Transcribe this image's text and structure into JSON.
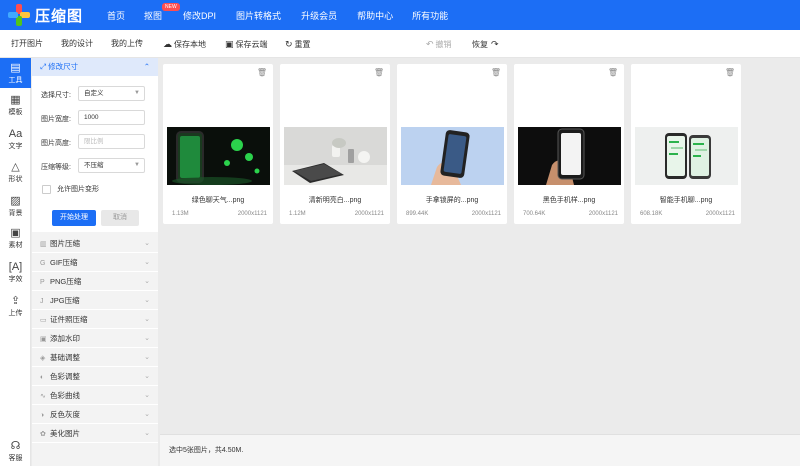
{
  "brand": {
    "name": "压缩图",
    "colors": {
      "primary": "#1c6ef5",
      "logo": [
        "#ff4d4f",
        "#ffc53d",
        "#52c41a",
        "#40a9ff"
      ]
    }
  },
  "nav": {
    "items": [
      {
        "label": "首页"
      },
      {
        "label": "抠图",
        "badge": "NEW"
      },
      {
        "label": "修改DPI"
      },
      {
        "label": "图片转格式"
      },
      {
        "label": "升级会员"
      },
      {
        "label": "帮助中心"
      },
      {
        "label": "所有功能"
      }
    ]
  },
  "toolbar": {
    "open_image": "打开图片",
    "my_designs": "我的设计",
    "my_uploads": "我的上传",
    "save_local": "保存本地",
    "save_cloud": "保存云端",
    "reset": "重置",
    "undo": "撤销",
    "redo": "恢复"
  },
  "rail": {
    "items": [
      {
        "label": "工具",
        "icon": "toolbox-icon",
        "active": true
      },
      {
        "label": "模板",
        "icon": "template-icon"
      },
      {
        "label": "文字",
        "icon": "text-icon"
      },
      {
        "label": "形状",
        "icon": "shapes-icon"
      },
      {
        "label": "背景",
        "icon": "background-icon"
      },
      {
        "label": "素材",
        "icon": "assets-icon"
      },
      {
        "label": "字效",
        "icon": "text-effect-icon"
      },
      {
        "label": "上传",
        "icon": "upload-icon"
      },
      {
        "label": "客服",
        "icon": "customer-service-icon"
      }
    ]
  },
  "panel": {
    "active_section": "修改尺寸",
    "form": {
      "size_label": "选择尺寸:",
      "size_value": "自定义",
      "width_label": "图片宽度:",
      "width_value": "1000",
      "height_label": "图片高度:",
      "height_placeholder": "限比例",
      "compress_label": "压缩等级:",
      "compress_value": "不压缩",
      "allow_deform": "允许图片变形",
      "start_button": "开始处理",
      "cancel_button": "取消"
    },
    "sections": [
      {
        "label": "图片压缩"
      },
      {
        "label": "GIF压缩"
      },
      {
        "label": "PNG压缩"
      },
      {
        "label": "JPG压缩"
      },
      {
        "label": "证件照压缩"
      },
      {
        "label": "添加水印"
      },
      {
        "label": "基础调整"
      },
      {
        "label": "色彩调整"
      },
      {
        "label": "色彩曲线"
      },
      {
        "label": "反色灰度"
      },
      {
        "label": "美化图片"
      }
    ]
  },
  "images": [
    {
      "name": "绿色聊天气...png",
      "size": "1.13M",
      "dims": "2000x1121"
    },
    {
      "name": "清新明亮白...png",
      "size": "1.12M",
      "dims": "2000x1121"
    },
    {
      "name": "手拿锁屏的...png",
      "size": "899.44K",
      "dims": "2000x1121"
    },
    {
      "name": "黑色手机样...png",
      "size": "700.64K",
      "dims": "2000x1121"
    },
    {
      "name": "智能手机聊...png",
      "size": "608.18K",
      "dims": "2000x1121"
    }
  ],
  "status": "选中5张图片，共4.50M."
}
